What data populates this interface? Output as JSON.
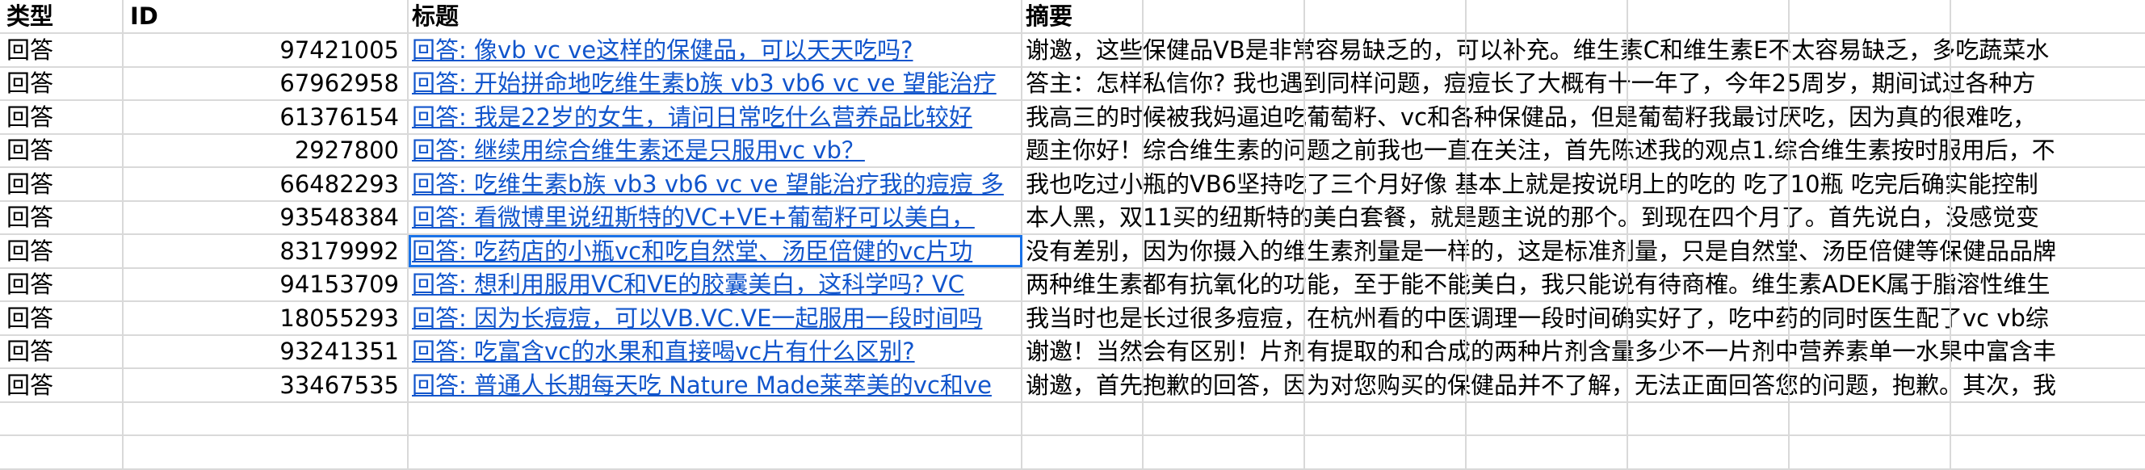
{
  "headers": {
    "type": "类型",
    "id": "ID",
    "title": "标题",
    "abstract": "摘要"
  },
  "rows": [
    {
      "type": "回答",
      "id": "97421005",
      "title": "回答: 像vb vc ve这样的保健品，可以天天吃吗?",
      "abstract": "谢邀，这些保健品VB是非常容易缺乏的，可以补充。维生素C和维生素E不太容易缺乏，多吃蔬菜水"
    },
    {
      "type": "回答",
      "id": "67962958",
      "title": "回答: 开始拼命地吃维生素b族 vb3 vb6 vc ve 望能治疗",
      "abstract": "答主：怎样私信你? 我也遇到同样问题，痘痘长了大概有十一年了，今年25周岁，期间试过各种方"
    },
    {
      "type": "回答",
      "id": "61376154",
      "title": "回答: 我是22岁的女生，请问日常吃什么营养品比较好",
      "abstract": "我高三的时候被我妈逼迫吃葡萄籽、vc和各种保健品，但是葡萄籽我最讨厌吃，因为真的很难吃，"
    },
    {
      "type": "回答",
      "id": "2927800",
      "title": "回答: 继续用综合维生素还是只服用vc vb？",
      "abstract": "题主你好！综合维生素的问题之前我也一直在关注，首先陈述我的观点1.综合维生素按时服用后，不"
    },
    {
      "type": "回答",
      "id": "66482293",
      "title": "回答: 吃维生素b族 vb3 vb6 vc ve 望能治疗我的痘痘 多",
      "abstract": "我也吃过小瓶的VB6坚持吃了三个月好像  基本上就是按说明上的吃的  吃了10瓶  吃完后确实能控制"
    },
    {
      "type": "回答",
      "id": "93548384",
      "title": "回答: 看微博里说纽斯特的VC+VE+葡萄籽可以美白，",
      "abstract": "本人黑，双11买的纽斯特的美白套餐，就是题主说的那个。到现在四个月了。首先说白，没感觉变"
    },
    {
      "type": "回答",
      "id": "83179992",
      "title": "回答: 吃药店的小瓶vc和吃自然堂、汤臣倍健的vc片功",
      "abstract": "没有差别，因为你摄入的维生素剂量是一样的，这是标准剂量，只是自然堂、汤臣倍健等保健品品牌"
    },
    {
      "type": "回答",
      "id": "94153709",
      "title": "回答: 想利用服用VC和VE的胶囊美白，这科学吗? VC",
      "abstract": "两种维生素都有抗氧化的功能，至于能不能美白，我只能说有待商榷。维生素ADEK属于脂溶性维生"
    },
    {
      "type": "回答",
      "id": "18055293",
      "title": "回答: 因为长痘痘，可以VB.VC.VE一起服用一段时间吗",
      "abstract": "我当时也是长过很多痘痘，在杭州看的中医调理一段时间确实好了，吃中药的同时医生配了vc vb综"
    },
    {
      "type": "回答",
      "id": "93241351",
      "title": "回答: 吃富含vc的水果和直接喝vc片有什么区别?",
      "abstract": "谢邀！当然会有区别！片剂有提取的和合成的两种片剂含量多少不一片剂中营养素单一水果中富含丰"
    },
    {
      "type": "回答",
      "id": "33467535",
      "title": "回答: 普通人长期每天吃 Nature Made莱萃美的vc和ve",
      "abstract": "谢邀，首先抱歉的回答，因为对您购买的保健品并不了解，无法正面回答您的问题，抱歉。其次，我"
    },
    {
      "type": "",
      "id": "",
      "title": "",
      "abstract": ""
    },
    {
      "type": "",
      "id": "",
      "title": "",
      "abstract": ""
    }
  ]
}
